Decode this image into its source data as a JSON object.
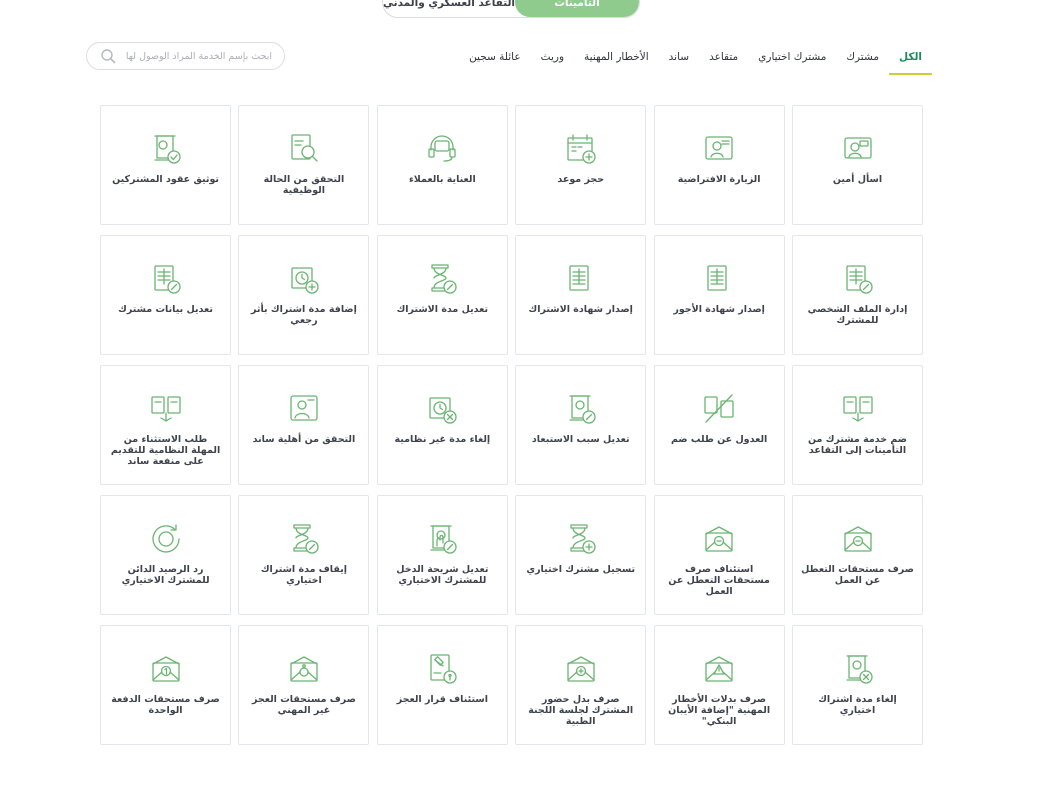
{
  "segments": {
    "active": "التأمينات",
    "other": "التقاعد العسكري والمدني"
  },
  "tabs": [
    "الكل",
    "مشترك",
    "مشترك اختياري",
    "متقاعد",
    "ساند",
    "الأخطار المهنية",
    "وريث",
    "عائلة سجين"
  ],
  "search": {
    "placeholder": "ابحث بإسم الخدمة المراد الوصول لها"
  },
  "colors": {
    "accent": "#8fcb8c",
    "tab_active": "#1f8a5c",
    "underline": "#c7d12f",
    "icon": "#6bb472"
  },
  "services": [
    {
      "label": "اسأل أمين",
      "icon": "chat-agent-icon"
    },
    {
      "label": "الزيارة الافتراضية",
      "icon": "video-call-icon"
    },
    {
      "label": "حجز موعد",
      "icon": "calendar-add-icon"
    },
    {
      "label": "العناية بالعملاء",
      "icon": "headset-icon"
    },
    {
      "label": "التحقق من الحالة الوظيفية",
      "icon": "document-search-icon"
    },
    {
      "label": "توثيق عقود المشتركين",
      "icon": "contract-verify-icon"
    },
    {
      "label": "إدارة الملف الشخصي للمشترك",
      "icon": "file-edit-icon"
    },
    {
      "label": "إصدار شهادة الأجور",
      "icon": "spreadsheet-icon"
    },
    {
      "label": "إصدار شهادة الاشتراك",
      "icon": "spreadsheet-icon"
    },
    {
      "label": "تعديل مدة الاشتراك",
      "icon": "hourglass-edit-icon"
    },
    {
      "label": "إضافة مدة اشتراك بأثر رجعي",
      "icon": "clock-add-icon"
    },
    {
      "label": "تعديل بيانات مشترك",
      "icon": "file-edit-icon"
    },
    {
      "label": "ضم خدمة مشترك من التأمينات إلى التقاعد",
      "icon": "files-transfer-icon"
    },
    {
      "label": "العدول عن طلب ضم",
      "icon": "files-cancel-icon"
    },
    {
      "label": "تعديل سبب الاستبعاد",
      "icon": "scroll-edit-icon"
    },
    {
      "label": "إلغاء مدة غير نظامية",
      "icon": "clock-remove-icon"
    },
    {
      "label": "التحقق من أهلية ساند",
      "icon": "agent-card-icon"
    },
    {
      "label": "طلب الاستثناء من المهلة النظامية للتقديم على منفعة ساند",
      "icon": "files-transfer-icon"
    },
    {
      "label": "صرف مستحقات التعطل عن العمل",
      "icon": "envelope-money-icon"
    },
    {
      "label": "استئناف صرف مستحقات التعطل عن العمل",
      "icon": "envelope-money-icon"
    },
    {
      "label": "تسجيل مشترك اختياري",
      "icon": "hourglass-add-icon"
    },
    {
      "label": "تعديل شريحة الدخل للمشترك الاختياري",
      "icon": "scroll-hand-icon"
    },
    {
      "label": "إيقاف مدة اشتراك اختياري",
      "icon": "hourglass-stop-icon"
    },
    {
      "label": "رد الرصيد الدائن للمشترك الاختياري",
      "icon": "refresh-coin-icon"
    },
    {
      "label": "إلغاء مدة اشتراك اختياري",
      "icon": "scroll-remove-icon"
    },
    {
      "label": "صرف بدلات الأخطار المهنية \"إضافة الأيبان البنكي\"",
      "icon": "envelope-alert-icon"
    },
    {
      "label": "صرف بدل حضور المشترك لجلسة اللجنة الطبية",
      "icon": "envelope-medical-icon"
    },
    {
      "label": "استئناف قرار العجز",
      "icon": "gavel-doc-icon"
    },
    {
      "label": "صرف مستحقات العجز غير المهني",
      "icon": "envelope-disability-icon"
    },
    {
      "label": "صرف مستحقات الدفعة الواحدة",
      "icon": "envelope-one-icon"
    }
  ]
}
